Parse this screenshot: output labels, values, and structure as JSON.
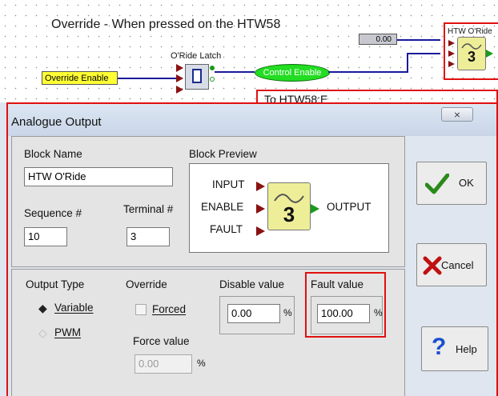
{
  "background": {
    "title": "Override - When pressed on the HTW58",
    "override_enable": "Override Enable",
    "latch_label": "O'Ride Latch",
    "control_enable": "Control Enable",
    "value_box": "0.00",
    "block_label": "HTW O'Ride",
    "block_number": "3",
    "to_label": "To HTW58:E"
  },
  "dialog": {
    "title": "Analogue Output",
    "close": "⨯"
  },
  "block_name": {
    "label": "Block Name",
    "value": "HTW O'Ride"
  },
  "sequence": {
    "label": "Sequence #",
    "value": "10"
  },
  "terminal": {
    "label": "Terminal #",
    "value": "3"
  },
  "preview": {
    "label": "Block Preview",
    "input": "INPUT",
    "enable": "ENABLE",
    "fault": "FAULT",
    "output": "OUTPUT",
    "number": "3"
  },
  "output_type": {
    "label": "Output Type",
    "variable": "Variable",
    "pwm": "PWM",
    "selected": "variable"
  },
  "override": {
    "label": "Override",
    "forced": "Forced",
    "force_value_label": "Force value",
    "force_value": "0.00",
    "unit": "%"
  },
  "disable_value": {
    "label": "Disable value",
    "value": "0.00",
    "unit": "%"
  },
  "fault_value": {
    "label": "Fault value",
    "value": "100.00",
    "unit": "%"
  },
  "buttons": {
    "ok": "OK",
    "cancel": "Cancel",
    "help": "Help"
  },
  "colors": {
    "accent_red": "#e01010",
    "wire_blue": "#1a1a9a",
    "block_yellow": "#eeee99",
    "green": "#22dd22"
  }
}
